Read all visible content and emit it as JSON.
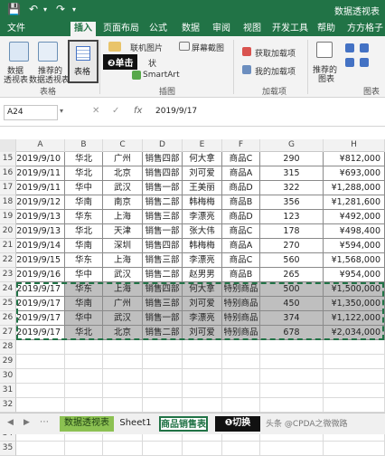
{
  "title_bar": {
    "document_title": "数据透视表"
  },
  "tabs": [
    {
      "label": "文件",
      "active": false
    },
    {
      "label": "插入",
      "active": true
    },
    {
      "label": "页面布局",
      "active": false
    },
    {
      "label": "公式",
      "active": false
    },
    {
      "label": "数据",
      "active": false
    },
    {
      "label": "审阅",
      "active": false
    },
    {
      "label": "视图",
      "active": false
    },
    {
      "label": "开发工具",
      "active": false
    },
    {
      "label": "帮助",
      "active": false
    },
    {
      "label": "方方格子",
      "active": false
    }
  ],
  "ribbon": {
    "pivot_table_label_1": "数据",
    "pivot_table_label_2": "透视表",
    "recommended_pivot_label_1": "推荐的",
    "recommended_pivot_label_2": "数据透视表",
    "table_label": "表格",
    "group_tables": "表格",
    "online_pictures": "联机图片",
    "screenshot": "屏幕截图",
    "shapes_partial": "状",
    "smartart": "SmartArt",
    "group_illustrations": "插图",
    "get_addins": "获取加载项",
    "my_addins": "我的加载项",
    "group_addins": "加载项",
    "recommended_charts_1": "推荐的",
    "recommended_charts_2": "图表",
    "group_charts": "图表",
    "callout_click": "❷单击"
  },
  "formula_bar": {
    "name_box": "A24",
    "fx": "fx",
    "value": "2019/9/17"
  },
  "columns": [
    "A",
    "B",
    "C",
    "D",
    "E",
    "F",
    "G",
    "H"
  ],
  "rows": [
    {
      "n": "15",
      "cells": [
        "2019/9/10",
        "华北",
        "广州",
        "销售四部",
        "何大拿",
        "商品C",
        "290",
        "¥812,000"
      ],
      "gray": false
    },
    {
      "n": "16",
      "cells": [
        "2019/9/11",
        "华北",
        "北京",
        "销售四部",
        "刘可爱",
        "商品A",
        "315",
        "¥693,000"
      ],
      "gray": false
    },
    {
      "n": "17",
      "cells": [
        "2019/9/11",
        "华中",
        "武汉",
        "销售一部",
        "王美丽",
        "商品D",
        "322",
        "¥1,288,000"
      ],
      "gray": false
    },
    {
      "n": "18",
      "cells": [
        "2019/9/12",
        "华南",
        "南京",
        "销售二部",
        "韩梅梅",
        "商品B",
        "356",
        "¥1,281,600"
      ],
      "gray": false
    },
    {
      "n": "19",
      "cells": [
        "2019/9/13",
        "华东",
        "上海",
        "销售三部",
        "李漂亮",
        "商品D",
        "123",
        "¥492,000"
      ],
      "gray": false
    },
    {
      "n": "20",
      "cells": [
        "2019/9/13",
        "华北",
        "天津",
        "销售一部",
        "张大伟",
        "商品C",
        "178",
        "¥498,400"
      ],
      "gray": false
    },
    {
      "n": "21",
      "cells": [
        "2019/9/14",
        "华南",
        "深圳",
        "销售四部",
        "韩梅梅",
        "商品A",
        "270",
        "¥594,000"
      ],
      "gray": false
    },
    {
      "n": "22",
      "cells": [
        "2019/9/15",
        "华东",
        "上海",
        "销售三部",
        "李漂亮",
        "商品C",
        "560",
        "¥1,568,000"
      ],
      "gray": false
    },
    {
      "n": "23",
      "cells": [
        "2019/9/16",
        "华中",
        "武汉",
        "销售二部",
        "赵男男",
        "商品B",
        "265",
        "¥954,000"
      ],
      "gray": false
    },
    {
      "n": "24",
      "cells": [
        "2019/9/17",
        "华东",
        "上海",
        "销售四部",
        "何大拿",
        "特别商品",
        "500",
        "¥1,500,000"
      ],
      "gray": true
    },
    {
      "n": "25",
      "cells": [
        "2019/9/17",
        "华南",
        "广州",
        "销售三部",
        "刘可爱",
        "特别商品",
        "450",
        "¥1,350,000"
      ],
      "gray": true
    },
    {
      "n": "26",
      "cells": [
        "2019/9/17",
        "华中",
        "武汉",
        "销售一部",
        "李漂亮",
        "特别商品",
        "374",
        "¥1,122,000"
      ],
      "gray": true
    },
    {
      "n": "27",
      "cells": [
        "2019/9/17",
        "华北",
        "北京",
        "销售二部",
        "刘可爱",
        "特别商品",
        "678",
        "¥2,034,000"
      ],
      "gray": true
    }
  ],
  "empty_rows": [
    "28",
    "29",
    "30",
    "31",
    "32",
    "33",
    "34",
    "35"
  ],
  "sheet_tabs": {
    "tab1": "数据透视表",
    "tab2": "Sheet1",
    "tab3": "商品销售表",
    "callout_switch": "❶切换",
    "watermark": "头条 @CPDA之微微路"
  }
}
